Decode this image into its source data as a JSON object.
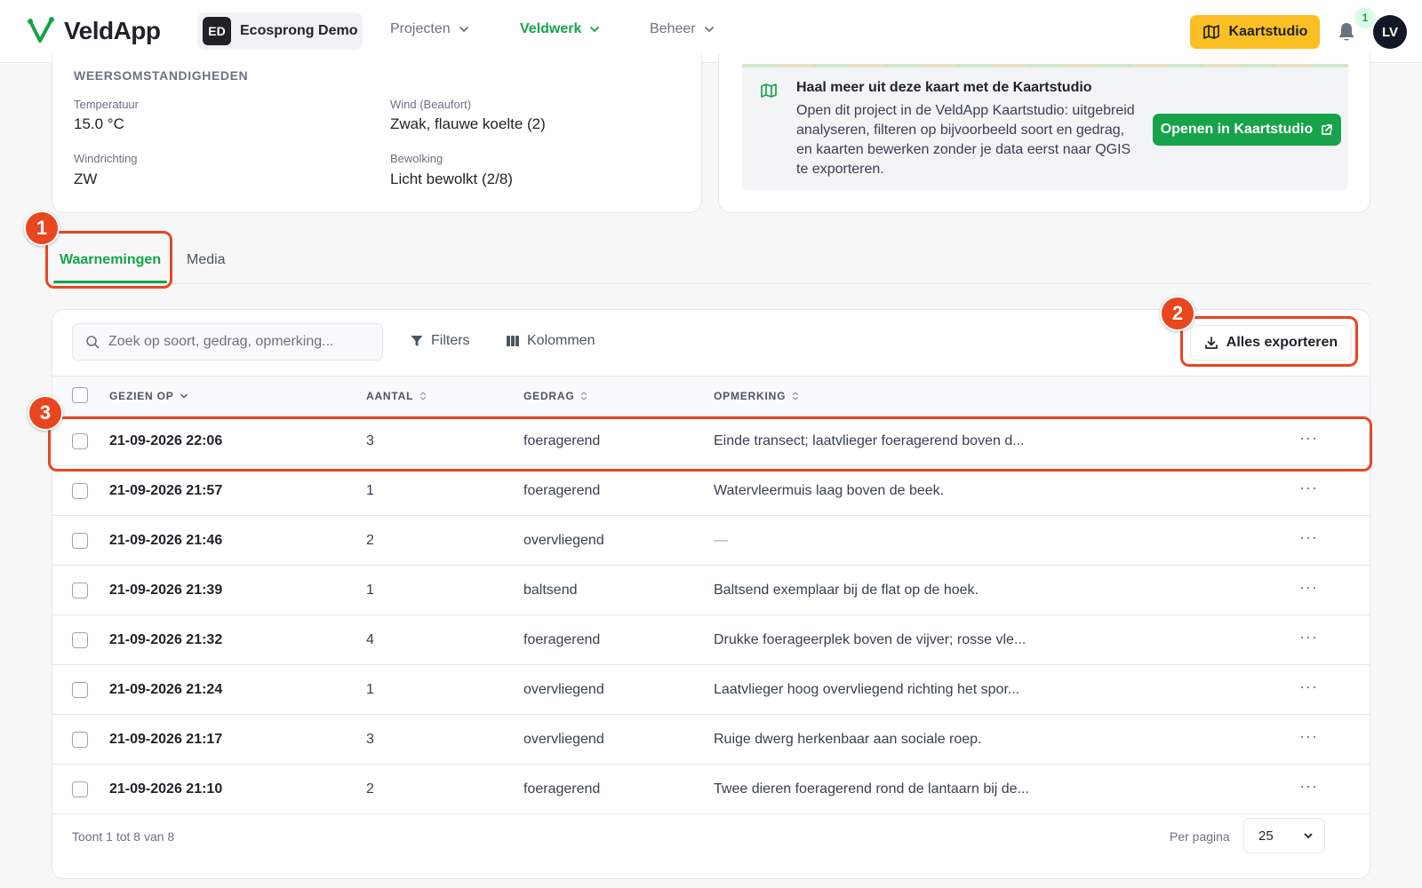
{
  "topnav": {
    "app_name": "VeldApp",
    "org_badge": "ED",
    "org_name": "Ecosprong Demo",
    "items": [
      {
        "label": "Projecten",
        "active": false
      },
      {
        "label": "Veldwerk",
        "active": true
      },
      {
        "label": "Beheer",
        "active": false
      }
    ],
    "kaartstudio_label": "Kaartstudio",
    "notification_count": "1",
    "avatar_initials": "LV"
  },
  "weather": {
    "title": "WEERSOMSTANDIGHEDEN",
    "fields": [
      {
        "label": "Temperatuur",
        "value": "15.0 °C"
      },
      {
        "label": "Wind (Beaufort)",
        "value": "Zwak, flauwe koelte (2)"
      },
      {
        "label": "Windrichting",
        "value": "ZW"
      },
      {
        "label": "Bewolking",
        "value": "Licht bewolkt (2/8)"
      }
    ]
  },
  "promo": {
    "title": "Haal meer uit deze kaart met de Kaartstudio",
    "body": "Open dit project in de VeldApp Kaartstudio: uitgebreid analyseren, filteren op bijvoorbeeld soort en gedrag, en kaarten bewerken zonder je data eerst naar QGIS te exporteren.",
    "button_label": "Openen in Kaartstudio"
  },
  "tabs": [
    {
      "label": "Waarnemingen",
      "active": true
    },
    {
      "label": "Media",
      "active": false
    }
  ],
  "toolbar": {
    "search_placeholder": "Zoek op soort, gedrag, opmerking...",
    "filters_label": "Filters",
    "columns_label": "Kolommen",
    "export_label": "Alles exporteren"
  },
  "table": {
    "columns": [
      "GEZIEN OP",
      "AANTAL",
      "GEDRAG",
      "OPMERKING"
    ],
    "rows": [
      {
        "date": "21-09-2026 22:06",
        "count": "3",
        "behavior": "foeragerend",
        "remark": "Einde transect; laatvlieger foeragerend boven d..."
      },
      {
        "date": "21-09-2026 21:57",
        "count": "1",
        "behavior": "foeragerend",
        "remark": "Watervleermuis laag boven de beek."
      },
      {
        "date": "21-09-2026 21:46",
        "count": "2",
        "behavior": "overvliegend",
        "remark": "—"
      },
      {
        "date": "21-09-2026 21:39",
        "count": "1",
        "behavior": "baltsend",
        "remark": "Baltsend exemplaar bij de flat op de hoek."
      },
      {
        "date": "21-09-2026 21:32",
        "count": "4",
        "behavior": "foeragerend",
        "remark": "Drukke foerageerplek boven de vijver; rosse vle..."
      },
      {
        "date": "21-09-2026 21:24",
        "count": "1",
        "behavior": "overvliegend",
        "remark": "Laatvlieger hoog overvliegend richting het spor..."
      },
      {
        "date": "21-09-2026 21:17",
        "count": "3",
        "behavior": "overvliegend",
        "remark": "Ruige dwerg herkenbaar aan sociale roep."
      },
      {
        "date": "21-09-2026 21:10",
        "count": "2",
        "behavior": "foeragerend",
        "remark": "Twee dieren foeragerend rond de lantaarn bij de..."
      }
    ],
    "row_menu_glyph": "···"
  },
  "pagination": {
    "summary": "Toont 1 tot 8 van 8",
    "per_page_label": "Per pagina",
    "per_page_value": "25"
  },
  "annotations": [
    "1",
    "2",
    "3"
  ],
  "colors": {
    "brand_green": "#16a34a",
    "accent_yellow": "#fbbf24",
    "annotation_red": "#e8461f"
  }
}
